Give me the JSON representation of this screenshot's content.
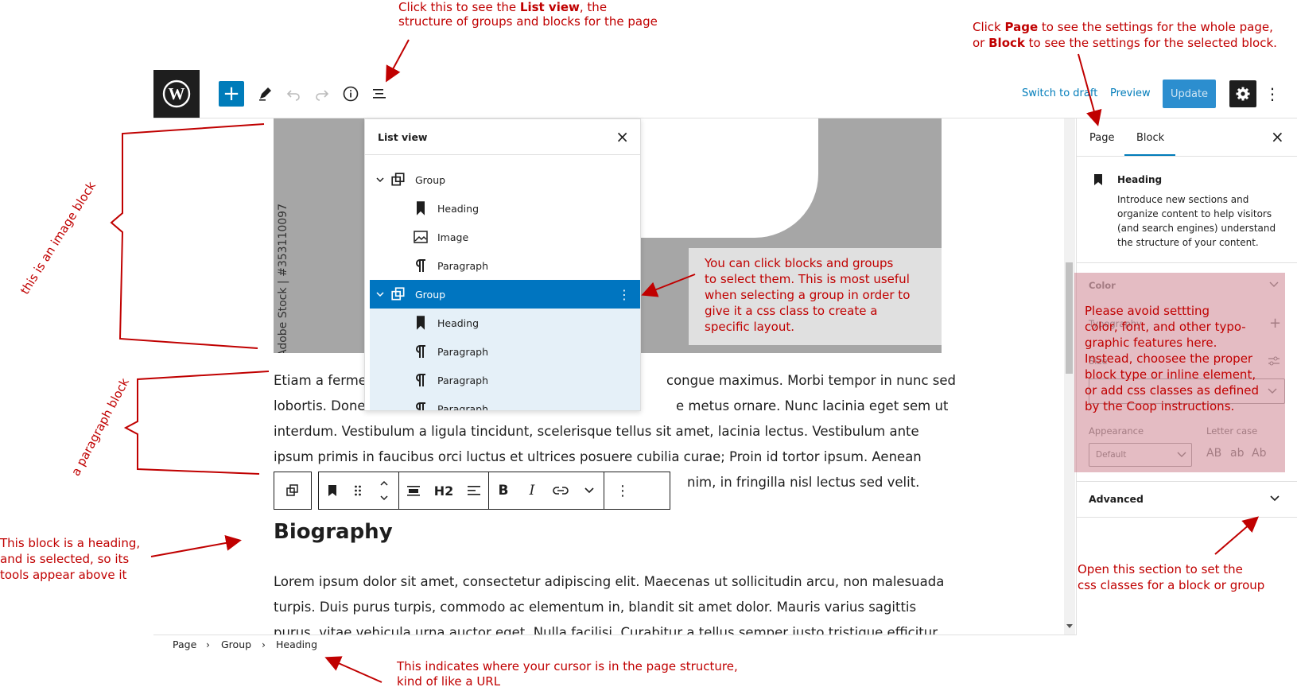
{
  "toolbar": {
    "switch_to_draft": "Switch to draft",
    "preview": "Preview",
    "update": "Update",
    "add_icon": "plus-icon",
    "add_symbol": "+"
  },
  "image_block": {
    "stock_text": "Adobe Stock | #353110097"
  },
  "list_view": {
    "title": "List view",
    "close_symbol": "×",
    "rows": [
      {
        "label": "Group",
        "icon": "group-icon"
      },
      {
        "label": "Heading",
        "icon": "heading-icon"
      },
      {
        "label": "Image",
        "icon": "image-icon"
      },
      {
        "label": "Paragraph",
        "icon": "paragraph-icon"
      },
      {
        "label": "Group",
        "icon": "group-icon"
      },
      {
        "label": "Heading",
        "icon": "heading-icon"
      },
      {
        "label": "Paragraph",
        "icon": "paragraph-icon"
      },
      {
        "label": "Paragraph",
        "icon": "paragraph-icon"
      },
      {
        "label": "Paragraph",
        "icon": "paragraph-icon"
      }
    ],
    "row_more_symbol": "⋮"
  },
  "content": {
    "para1_lines": [
      "Etiam a ferme",
      "congue maximus. Morbi tempor in nunc sed",
      "lobortis. Done",
      "e metus ornare. Nunc lacinia eget sem ut",
      "interdum. Vestibulum a ligula tincidunt, scelerisque tellus sit amet, lacinia lectus. Vestibulum ante",
      "ipsum primis in faucibus orci luctus et ultrices posuere cubilia curae; Proin id tortor ipsum. Aenean",
      "nim, in fringilla nisl lectus sed velit."
    ],
    "heading": "Biography",
    "para2_lines": [
      "Lorem ipsum dolor sit amet, consectetur adipiscing elit. Maecenas ut sollicitudin arcu, non malesuada",
      "turpis. Duis purus turpis, commodo ac elementum in, blandit sit amet dolor. Mauris varius sagittis",
      "purus, vitae vehicula urna auctor eget. Nulla facilisi. Curabitur a tellus semper justo tristique efficitur id"
    ]
  },
  "block_toolbar": {
    "heading_level": "H2"
  },
  "sidebar": {
    "tab_page": "Page",
    "tab_block": "Block",
    "close_symbol": "×",
    "block_name": "Heading",
    "block_desc_lines": [
      "Introduce new sections and",
      "organize content to help visitors",
      "(and search engines) understand",
      "the structure of your content."
    ],
    "color_label": "Color",
    "typography_label": "Typography",
    "size_label": "Size",
    "appearance_label": "Appearance",
    "appearance_value": "Default",
    "letter_case_label": "Letter case",
    "letter_case_options": [
      "AB",
      "ab",
      "Ab"
    ],
    "advanced_label": "Advanced"
  },
  "breadcrumb": {
    "items": [
      "Page",
      "Group",
      "Heading"
    ],
    "separator": "›"
  },
  "annotations": {
    "list_view_note_pre": "Click this to see the ",
    "list_view_note_bold": "List view",
    "list_view_note_post": ", the",
    "list_view_note_line2": "structure of groups and blocks for the page",
    "page_block_line1_pre": "Click ",
    "page_block_line1_bold": "Page",
    "page_block_line1_post": " to see the settings for the whole page,",
    "page_block_line2_pre": "or ",
    "page_block_line2_bold": "Block",
    "page_block_line2_post": " to see the settings for the selected block.",
    "image_block_note": "this  is an image block",
    "paragraph_block_note": "a paragraph block",
    "select_note_lines": [
      "You can click blocks and groups",
      "to select them. This is most useful",
      "when selecting a group in order to",
      "give it a css class to create a",
      "specific layout."
    ],
    "avoid_note_lines": [
      "Please avoid settting",
      "color, font, and other typo-",
      "graphic features here.",
      "Instead,  choosee the proper",
      "block type or inline element,",
      "or add css classes as defined",
      "by the Coop instructions."
    ],
    "heading_note_lines": [
      "This block is a heading,",
      "and is selected, so its",
      "tools appear above it"
    ],
    "advanced_note_lines": [
      "Open this section to set the",
      "css classes for a block or group"
    ],
    "breadcrumb_note_lines": [
      "This indicates where your cursor is in the page structure,",
      "kind of like a URL"
    ]
  },
  "colors": {
    "accent": "#007cba",
    "annotation": "#c00000",
    "selected_row": "#0075c0"
  }
}
